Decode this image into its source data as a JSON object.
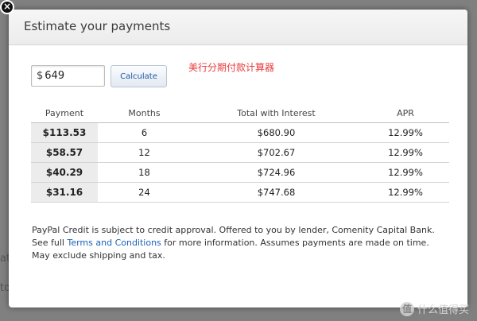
{
  "modal": {
    "title": "Estimate your payments",
    "amount": {
      "currency": "$",
      "value": "649"
    },
    "calculate_label": "Calculate",
    "annotation": "美行分期付款计算器",
    "table": {
      "headers": [
        "Payment",
        "Months",
        "Total with Interest",
        "APR"
      ],
      "rows": [
        [
          "$113.53",
          "6",
          "$680.90",
          "12.99%"
        ],
        [
          "$58.57",
          "12",
          "$702.67",
          "12.99%"
        ],
        [
          "$40.29",
          "18",
          "$724.96",
          "12.99%"
        ],
        [
          "$31.16",
          "24",
          "$747.68",
          "12.99%"
        ]
      ]
    },
    "disclaimer": {
      "part1": "PayPal Credit is subject to credit approval. Offered to you by lender, Comenity Capital Bank. See full",
      "link": "Terms and Conditions",
      "part2": "for more information. Assumes payments are made on time. May exclude shipping and tax."
    }
  },
  "close_glyph": "×",
  "watermark": {
    "badge": "值",
    "text": "什么值得买"
  },
  "background_fragments": [
    "at",
    "to"
  ],
  "colors": {
    "link": "#1a61b8",
    "annotation": "#e83b3b",
    "overlay": "#808080"
  }
}
